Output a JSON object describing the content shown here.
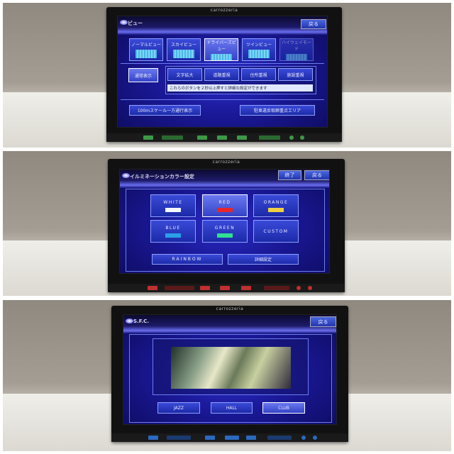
{
  "brand": "carrozzeria",
  "panel1": {
    "title": "ビュー",
    "back": "戻る",
    "views": [
      {
        "label": "ノーマルビュー"
      },
      {
        "label": "スカイビュー"
      },
      {
        "label": "ドライバーズビュー",
        "selected": true
      },
      {
        "label": "ツインビュー"
      },
      {
        "label": "ハイウェイモード",
        "disabled": true
      }
    ],
    "normal": "通常表示",
    "modes": [
      "文字拡大",
      "道路重視",
      "住所重視",
      "施設重視"
    ],
    "hint": "これらのボタンを２秒以上押すと詳細な設定ができます",
    "oneway": "100mスケール一方通行表示",
    "parking": "駐車違反取締重点エリア"
  },
  "panel2": {
    "title": "イルミネーションカラー設定",
    "end": "終了",
    "back": "戻る",
    "colors": [
      {
        "label": "WHITE",
        "swatch": "#f4f8ff"
      },
      {
        "label": "RED",
        "swatch": "#e8262a",
        "selected": true
      },
      {
        "label": "ORANGE",
        "swatch": "#f0d040"
      },
      {
        "label": "BLUE",
        "swatch": "#2aa0e8"
      },
      {
        "label": "GREEN",
        "swatch": "#30e090"
      },
      {
        "label": "CUSTOM"
      }
    ],
    "rainbow": "RAINBOW",
    "detail": "詳細設定"
  },
  "panel3": {
    "title": "S.F.C.",
    "back": "戻る",
    "modes": [
      {
        "label": "JAZZ"
      },
      {
        "label": "HALL"
      },
      {
        "label": "CLUB",
        "selected": true
      }
    ]
  },
  "colors": {
    "screen": "#1a1896",
    "button": "#2a38c0",
    "hardkey_green": "#3c9a48",
    "hardkey_red": "#c03030",
    "hardkey_blue": "#2a6ac0"
  }
}
